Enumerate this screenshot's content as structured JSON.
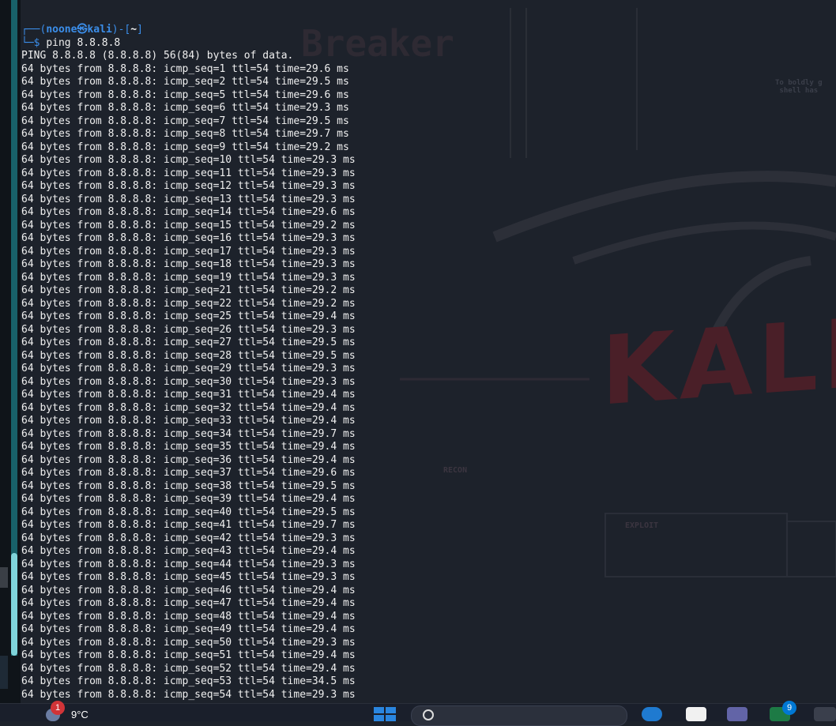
{
  "terminal": {
    "prompt_user": "noone",
    "prompt_at": "㉿",
    "prompt_host": "kali",
    "prompt_dir": "~",
    "command": "ping 8.8.8.8",
    "header": "PING 8.8.8.8 (8.8.8.8) 56(84) bytes of data.",
    "replies": [
      {
        "seq": 1,
        "time": "29.6"
      },
      {
        "seq": 2,
        "time": "29.5"
      },
      {
        "seq": 5,
        "time": "29.6"
      },
      {
        "seq": 6,
        "time": "29.3"
      },
      {
        "seq": 7,
        "time": "29.5"
      },
      {
        "seq": 8,
        "time": "29.7"
      },
      {
        "seq": 9,
        "time": "29.2"
      },
      {
        "seq": 10,
        "time": "29.3"
      },
      {
        "seq": 11,
        "time": "29.3"
      },
      {
        "seq": 12,
        "time": "29.3"
      },
      {
        "seq": 13,
        "time": "29.3"
      },
      {
        "seq": 14,
        "time": "29.6"
      },
      {
        "seq": 15,
        "time": "29.2"
      },
      {
        "seq": 16,
        "time": "29.3"
      },
      {
        "seq": 17,
        "time": "29.3"
      },
      {
        "seq": 18,
        "time": "29.3"
      },
      {
        "seq": 19,
        "time": "29.3"
      },
      {
        "seq": 21,
        "time": "29.2"
      },
      {
        "seq": 22,
        "time": "29.2"
      },
      {
        "seq": 25,
        "time": "29.4"
      },
      {
        "seq": 26,
        "time": "29.3"
      },
      {
        "seq": 27,
        "time": "29.5"
      },
      {
        "seq": 28,
        "time": "29.5"
      },
      {
        "seq": 29,
        "time": "29.3"
      },
      {
        "seq": 30,
        "time": "29.3"
      },
      {
        "seq": 31,
        "time": "29.4"
      },
      {
        "seq": 32,
        "time": "29.4"
      },
      {
        "seq": 33,
        "time": "29.4"
      },
      {
        "seq": 34,
        "time": "29.7"
      },
      {
        "seq": 35,
        "time": "29.4"
      },
      {
        "seq": 36,
        "time": "29.4"
      },
      {
        "seq": 37,
        "time": "29.6"
      },
      {
        "seq": 38,
        "time": "29.5"
      },
      {
        "seq": 39,
        "time": "29.4"
      },
      {
        "seq": 40,
        "time": "29.5"
      },
      {
        "seq": 41,
        "time": "29.7"
      },
      {
        "seq": 42,
        "time": "29.3"
      },
      {
        "seq": 43,
        "time": "29.4"
      },
      {
        "seq": 44,
        "time": "29.3"
      },
      {
        "seq": 45,
        "time": "29.3"
      },
      {
        "seq": 46,
        "time": "29.4"
      },
      {
        "seq": 47,
        "time": "29.4"
      },
      {
        "seq": 48,
        "time": "29.4"
      },
      {
        "seq": 49,
        "time": "29.4"
      },
      {
        "seq": 50,
        "time": "29.3"
      },
      {
        "seq": 51,
        "time": "29.4"
      },
      {
        "seq": 52,
        "time": "29.4"
      },
      {
        "seq": 53,
        "time": "34.5"
      },
      {
        "seq": 54,
        "time": "29.3"
      }
    ],
    "reply_prefix": "64 bytes from 8.8.8.8: icmp_seq=",
    "ttl_text": " ttl=54 time=",
    "unit": " ms"
  },
  "taskbar": {
    "weather_badge": "1",
    "temperature": "9°C",
    "app_badge": "9",
    "icons": [
      "weather-icon",
      "start-icon",
      "search-icon",
      "edge-icon",
      "file-explorer-icon",
      "teams-icon",
      "excel-icon"
    ]
  },
  "colors": {
    "terminal_bg": "#1d222b",
    "prompt_blue": "#3b8eea",
    "text": "#f0f0f0",
    "kali_red": "#4a1f28"
  }
}
